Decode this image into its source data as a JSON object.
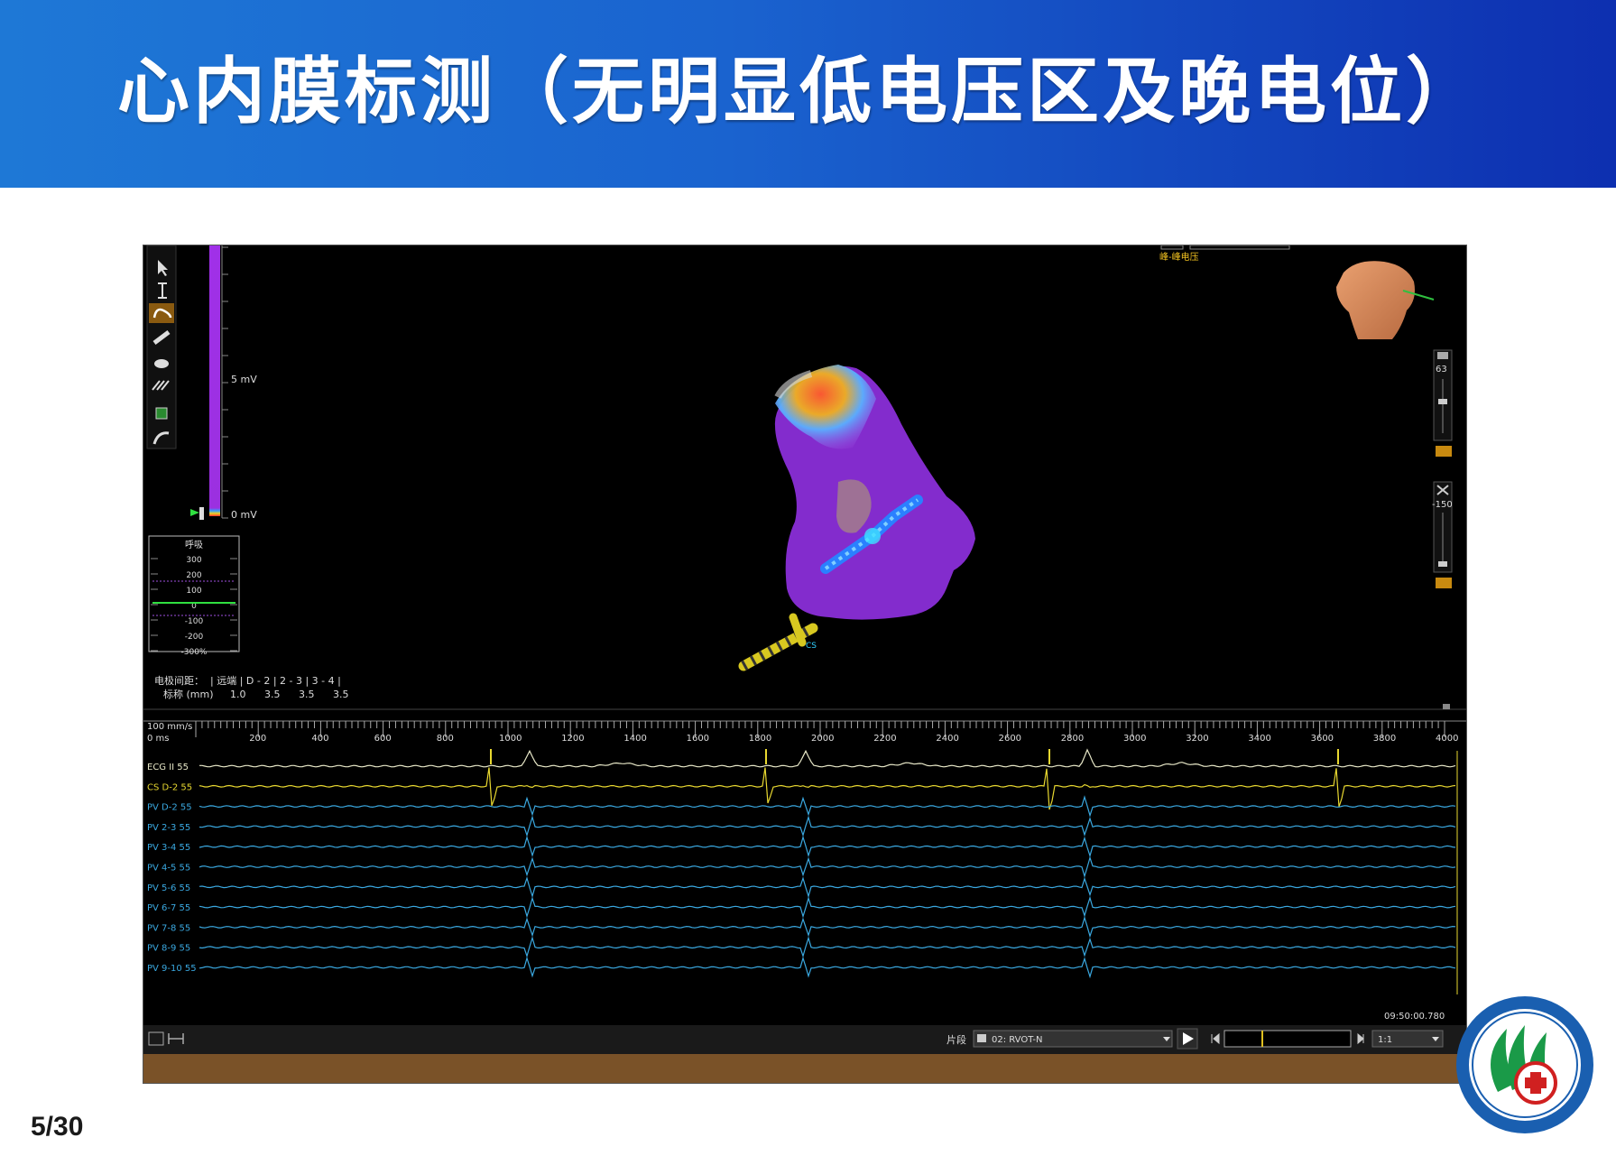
{
  "slide": {
    "title": "心内膜标测（无明显低电压区及晚电位）",
    "page_number": "5/30"
  },
  "map_view": {
    "scale_top_label": "5 mV",
    "scale_bottom_label": "0 mV",
    "top_right_label": "峰-峰电压",
    "zoom_value": "63",
    "clip_value": "-150",
    "catheter_label": "CS"
  },
  "respiration": {
    "title": "呼吸",
    "ticks": [
      "300",
      "200",
      "100",
      "0",
      "-100",
      "-200",
      "-300%"
    ]
  },
  "electrode_spacing": {
    "row1": "电极间距：  | 远端 | D - 2 | 2 - 3 | 3 - 4 |",
    "row2_label": "标称 (mm)",
    "row2_values": [
      "1.0",
      "3.5",
      "3.5",
      "3.5"
    ]
  },
  "timeline": {
    "speed": "100 mm/s",
    "start": "0 ms",
    "ticks": [
      "200",
      "400",
      "600",
      "800",
      "1000",
      "1200",
      "1400",
      "1600",
      "1800",
      "2000",
      "2200",
      "2400",
      "2600",
      "2800",
      "3000",
      "3200",
      "3400",
      "3600",
      "3800",
      "4000"
    ],
    "timestamp": "09:50:00.780"
  },
  "channels": [
    {
      "label": "ECG II 55",
      "color": "#e8e8c8"
    },
    {
      "label": "CS   D-2 55",
      "color": "#e8d830"
    },
    {
      "label": "PV   D-2 55",
      "color": "#3aa8e0"
    },
    {
      "label": "PV   2-3 55",
      "color": "#3aa8e0"
    },
    {
      "label": "PV   3-4 55",
      "color": "#3aa8e0"
    },
    {
      "label": "PV   4-5 55",
      "color": "#3aa8e0"
    },
    {
      "label": "PV   5-6 55",
      "color": "#3aa8e0"
    },
    {
      "label": "PV   6-7 55",
      "color": "#3aa8e0"
    },
    {
      "label": "PV   7-8 55",
      "color": "#3aa8e0"
    },
    {
      "label": "PV   8-9 55",
      "color": "#3aa8e0"
    },
    {
      "label": "PV   9-10 55",
      "color": "#3aa8e0"
    }
  ],
  "bottom_bar": {
    "segment_label": "片段",
    "segment_value": "02: RVOT-N",
    "speed_ratio": "1:1"
  },
  "colors": {
    "banner_start": "#1e78d6",
    "banner_end": "#0d2fb0",
    "voltage_bar": "#9b30e0",
    "ecg_trace": "#e8e8c8",
    "cs_trace": "#e8d830",
    "pv_trace": "#3aa8e0",
    "panel_footer": "#7a5228"
  }
}
